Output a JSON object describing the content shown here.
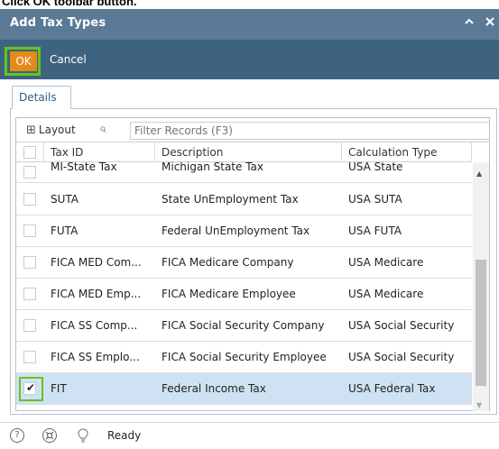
{
  "caption": "Click OK toolbar button.",
  "window": {
    "title": "Add Tax Types",
    "collapse_icon": "chevron-up-icon",
    "close_icon": "close-icon"
  },
  "toolbar": {
    "ok_label": "OK",
    "cancel_label": "Cancel",
    "accent_ok": "#e58a1a"
  },
  "tabs": [
    {
      "label": "Details",
      "active": true
    }
  ],
  "grid": {
    "layout_label": "Layout",
    "filter_placeholder": "Filter Records (F3)",
    "columns": [
      "Tax ID",
      "Description",
      "Calculation Type"
    ],
    "rows": [
      {
        "tax_id": "MI-State Tax",
        "description": "Michigan State Tax",
        "calc_type": "USA State",
        "checked": false
      },
      {
        "tax_id": "SUTA",
        "description": "State UnEmployment Tax",
        "calc_type": "USA SUTA",
        "checked": false
      },
      {
        "tax_id": "FUTA",
        "description": "Federal UnEmployment Tax",
        "calc_type": "USA FUTA",
        "checked": false
      },
      {
        "tax_id": "FICA MED Com...",
        "description": "FICA Medicare Company",
        "calc_type": "USA Medicare",
        "checked": false
      },
      {
        "tax_id": "FICA MED Emp...",
        "description": "FICA Medicare Employee",
        "calc_type": "USA Medicare",
        "checked": false
      },
      {
        "tax_id": "FICA SS Comp...",
        "description": "FICA Social Security Company",
        "calc_type": "USA Social Security",
        "checked": false
      },
      {
        "tax_id": "FICA SS Emplo...",
        "description": "FICA Social Security Employee",
        "calc_type": "USA Social Security",
        "checked": false
      },
      {
        "tax_id": "FIT",
        "description": "Federal Income Tax",
        "calc_type": "USA Federal Tax",
        "checked": true
      }
    ],
    "selected_color": "#cfe2f3"
  },
  "status": {
    "text": "Ready",
    "icons": [
      "help-icon",
      "support-icon",
      "lightbulb-icon"
    ]
  },
  "highlight_color": "#63c51c"
}
